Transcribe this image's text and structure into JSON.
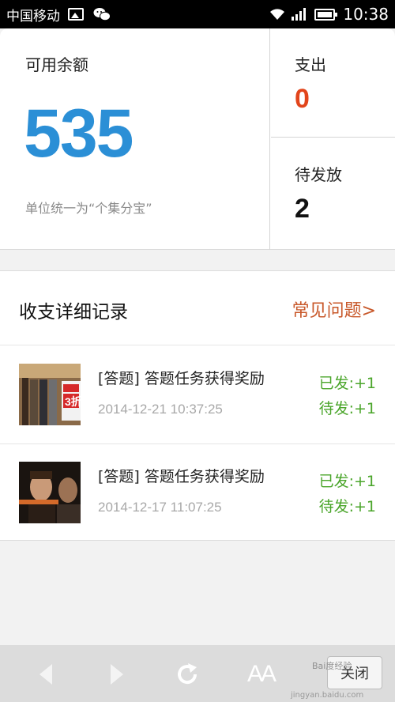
{
  "status_bar": {
    "carrier": "中国移动",
    "time": "10:38"
  },
  "balance": {
    "title": "可用余额",
    "amount": "535",
    "unit_note": "单位统一为“个集分宝”"
  },
  "stats": {
    "expense_label": "支出",
    "expense_value": "0",
    "pending_label": "待发放",
    "pending_value": "2"
  },
  "records": {
    "title": "收支详细记录",
    "faq_link": "常见问题>",
    "items": [
      {
        "name": "[答题] 答题任务获得奖励",
        "time": "2014-12-21 10:37:25",
        "sent": "已发:+1",
        "pending": "待发:+1"
      },
      {
        "name": "[答题] 答题任务获得奖励",
        "time": "2014-12-17 11:07:25",
        "sent": "已发:+1",
        "pending": "待发:+1"
      }
    ]
  },
  "toolbar": {
    "close_label": "关闭",
    "font_label": "AA"
  },
  "watermark": {
    "text": "Bai度经验",
    "url": "jingyan.baidu.com"
  },
  "colors": {
    "accent_blue": "#2b8fd6",
    "expense_red": "#e2451b",
    "link_orange": "#c8582a",
    "reward_green": "#4aa52a"
  }
}
